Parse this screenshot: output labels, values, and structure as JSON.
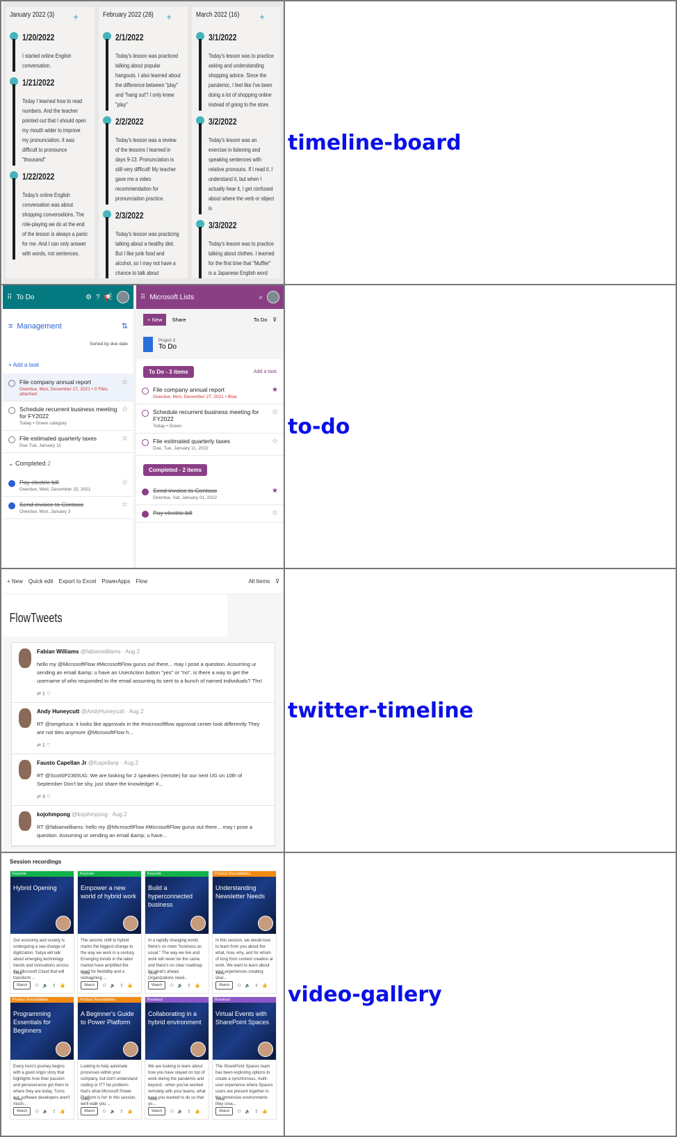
{
  "rows": [
    {
      "label": "timeline-board"
    },
    {
      "label": "to-do"
    },
    {
      "label": "twitter-timeline"
    },
    {
      "label": "video-gallery"
    }
  ],
  "timeline": {
    "columns": [
      {
        "header": "January 2022 (3)",
        "entries": [
          {
            "date": "1/20/2022",
            "text": "I started online English conversation."
          },
          {
            "date": "1/21/2022",
            "text": "Today I learned how to read numbers. And the teacher pointed out that I should open my mouth wider to improve my pronunciation. It was difficult to pronounce \"thousand\""
          },
          {
            "date": "1/22/2022",
            "text": "Today's online English conversation was about shopping conversations. The role-playing we do at the end of the lesson is always a panic for me. And I can only answer with words, not sentences."
          }
        ]
      },
      {
        "header": "February 2022 (28)",
        "entries": [
          {
            "date": "2/1/2022",
            "text": "Today's lesson was practiced talking about popular hangouts. I also learned about the difference between \"play\" and \"hang out\"! I only knew \"play\""
          },
          {
            "date": "2/2/2022",
            "text": "Today's lesson was a review of the lessons I learned in days 9-13. Pronunciation is still very difficult! My teacher gave me a video recommendation for pronunciation practice."
          },
          {
            "date": "2/3/2022",
            "text": "Today's lesson was practicing talking about a healthy diet. But I like junk food and alcohol, so I may not have a chance to talk about"
          }
        ]
      },
      {
        "header": "March 2022 (16)",
        "entries": [
          {
            "date": "3/1/2022",
            "text": "Today's lesson was to practice asking and understanding shopping advice. Since the pandemic, I feel like I've been doing a lot of shopping online instead of going to the store."
          },
          {
            "date": "3/2/2022",
            "text": "Today's lesson was an exercise in listening and speaking sentences with relative pronouns. If I read it, I understand it, but when I actually hear it, I get confused about where the verb or object is"
          },
          {
            "date": "3/3/2022",
            "text": "Today's lesson was to practice talking about clothes. I learned for the first time that \"Muffler\" is a Japanese English word"
          }
        ]
      }
    ]
  },
  "todo": {
    "left": {
      "app": "To Do",
      "list": "Management",
      "sort": "Sorted by due date",
      "add": "Add a task",
      "tasks": [
        {
          "title": "File company annual report",
          "meta": "Overdue, Mon, December 27, 2021 • 0 Files attached"
        },
        {
          "title": "Schedule recurrent business meeting for FY2022",
          "meta": "Today • Green category"
        },
        {
          "title": "File estimated quarterly taxes",
          "meta": "Due Tue, January 11"
        }
      ],
      "completed": "Completed",
      "completed_count": "2",
      "done": [
        {
          "title": "Pay electric bill",
          "meta": "Overdue, Wed, December 15, 2021"
        },
        {
          "title": "Send invoice to Contoso",
          "meta": "Overdue, Mon, January 3"
        }
      ]
    },
    "right": {
      "app": "Microsoft Lists",
      "new": "New",
      "share": "Share",
      "view": "To Do",
      "project": "Project X",
      "title": "To Do",
      "group1": "To Do - 3 items",
      "add": "Add a task",
      "tasks": [
        {
          "title": "File company annual report",
          "meta": "Overdue, Mon, December 27, 2021 • Blue"
        },
        {
          "title": "Schedule recurrent business meeting for FY2022",
          "meta": "Today • Green"
        },
        {
          "title": "File estimated quarterly taxes",
          "meta": "Due, Tue, January 11, 2022"
        }
      ],
      "group2": "Completed - 2 items",
      "done": [
        {
          "title": "Send invoice to Contoso",
          "meta": "Overdue, Sat, January 01, 2022"
        },
        {
          "title": "Pay electric bill",
          "meta": ""
        }
      ]
    }
  },
  "twitter": {
    "toolbar": [
      "New",
      "Quick edit",
      "Export to Excel",
      "PowerApps",
      "Flow",
      "All Items"
    ],
    "title": "FlowTweets",
    "tweets": [
      {
        "name": "Fabian Williams",
        "handle": "@fabianwilliams · Aug 2",
        "text": "hello my @MicrosoftFlow #MicrosoftFlow gurus out there... may i pose a question. Assuming ur sending an email &amp; u have an UserAction button \"yes\" or \"no\", is there a way to get the username of who responded to the email assuming its sent to a bunch of named individuals? Thx!",
        "count": "1"
      },
      {
        "name": "Andy Huneycutt",
        "handle": "@AndyHuneycutt · Aug 2",
        "text": "RT @sergeluca: it looks like approvals in the #microsoftflow approval center look differently They are not tiles anymore @MicrosoftFlow h...",
        "count": "1"
      },
      {
        "name": "Fausto Capellan Jr",
        "handle": "@fcapellanjr · Aug 2",
        "text": "RT @ScotSP2365UG: We are looking for 2 speakers (remote) for our next UG on 10th of September Don't be shy, just share the knowledge! #...",
        "count": "3"
      },
      {
        "name": "kojohmpong",
        "handle": "@kojohmpong · Aug 2",
        "text": "RT @fabianwilliams: hello my @MicrosoftFlow #MicrosoftFlow gurus out there... may i pose a question. Assuming ur sending an email &amp; u have...",
        "count": ""
      }
    ]
  },
  "video": {
    "title": "Session recordings",
    "watch": "Watch",
    "today": "Today",
    "cards": [
      {
        "tag": "Keynote",
        "tagColor": "#12b24a",
        "title": "Hybrid Opening",
        "desc": "Our economy and society is undergoing a sea change of digitization. Satya will talk about emerging technology trends and innovations across the Microsoft Cloud that will transform ..."
      },
      {
        "tag": "Keynote",
        "tagColor": "#12b24a",
        "title": "Empower a new world of hybrid work",
        "desc": "The seismic shift to hybrid marks the biggest change to the way we work in a century. Emerging trends in the labor market have amplified the need for flexibility and a reimagining ..."
      },
      {
        "tag": "Keynote",
        "tagColor": "#12b24a",
        "title": "Build a hyperconnected business",
        "desc": "In a rapidly changing world, there's no more \"business as usual.\" The way we live and work will never be the same, and there's no clear roadmap for what's ahead. Organizations need..."
      },
      {
        "tag": "Product Roundtables",
        "tagColor": "#f28a12",
        "title": "Understanding Newsletter Needs",
        "desc": "In this session, we would love to learn from you about the what, how, why, and for whom of long form content creation at work. We want to learn about your experiences creating shar..."
      },
      {
        "tag": "Product Roundtables",
        "tagColor": "#f28a12",
        "title": "Programming Essentials for Beginners",
        "desc": "Every hero's journey begins with a good origin story that highlights how their passion and perseverance got them to where they are today. Turns out, software developers aren't much..."
      },
      {
        "tag": "Product Roundtables",
        "tagColor": "#f28a12",
        "title": "A Beginner's Guide to Power Platform",
        "desc": "Looking to help automate processes within your company, but don't understand coding or IT? No problem- that's what Microsoft Power Platform is for! In this session, we'll walk you ..."
      },
      {
        "tag": "Breakout",
        "tagColor": "#8a57c7",
        "title": "Collaborating in a hybrid environment",
        "desc": "We are looking to learn about how you have stayed on top of work during the pandemic and beyond - when you've worked remotely with your teams, what have you wanted to do so that yo..."
      },
      {
        "tag": "Breakout",
        "tagColor": "#8a57c7",
        "title": "Virtual Events with SharePoint Spaces",
        "desc": "The SharePoint Spaces team has been exploring options to create a synchronous, multi-user experience where Spaces users are present together in the immersive environments they crea..."
      }
    ]
  }
}
